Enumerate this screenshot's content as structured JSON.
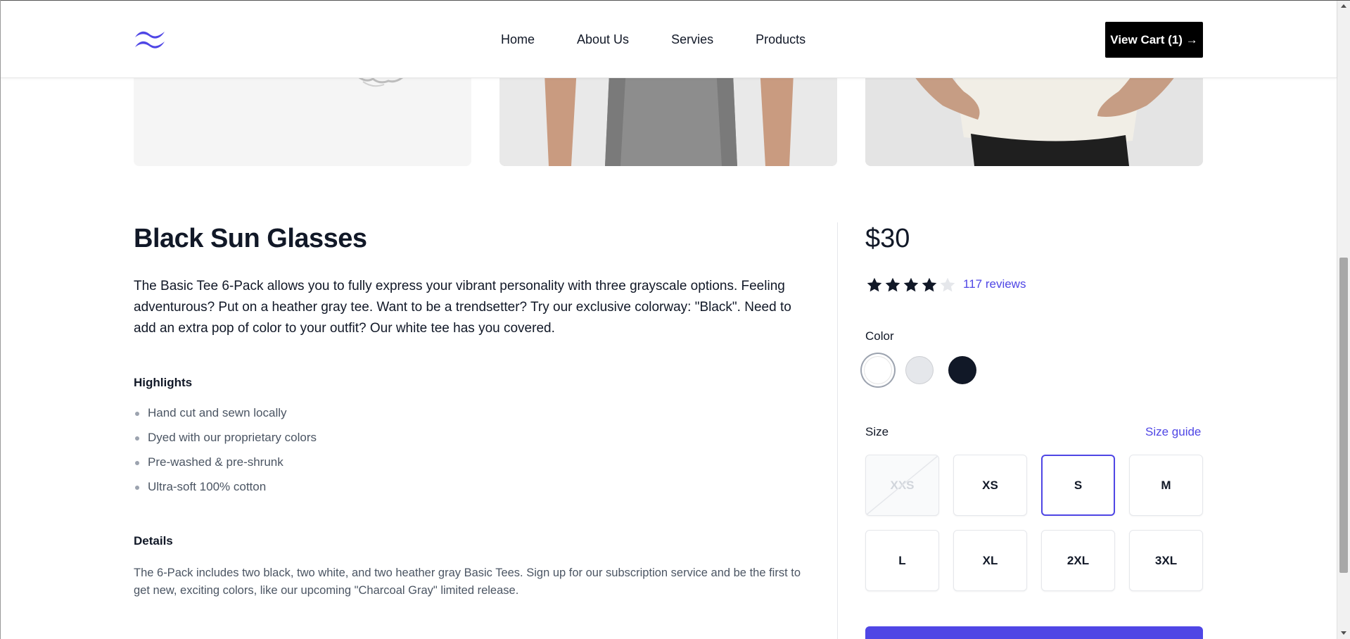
{
  "nav": {
    "links": [
      "Home",
      "About Us",
      "Servies",
      "Products"
    ],
    "cart_label": "View Cart (1) →"
  },
  "colors": {
    "accent": "#4f46e5",
    "text": "#111827",
    "muted": "#4b5563"
  },
  "product": {
    "title": "Black Sun Glasses",
    "description": "The Basic Tee 6-Pack allows you to fully express your vibrant personality with three grayscale options. Feeling adventurous? Put on a heather gray tee. Want to be a trendsetter? Try our exclusive colorway: \"Black\". Need to add an extra pop of color to your outfit? Our white tee has you covered.",
    "highlights_heading": "Highlights",
    "highlights": [
      "Hand cut and sewn locally",
      "Dyed with our proprietary colors",
      "Pre-washed & pre-shrunk",
      "Ultra-soft 100% cotton"
    ],
    "details_heading": "Details",
    "details": "The 6-Pack includes two black, two white, and two heather gray Basic Tees. Sign up for our subscription service and be the first to get new, exciting colors, like our upcoming \"Charcoal Gray\" limited release.",
    "price": "$30",
    "rating": 4,
    "rating_max": 5,
    "reviews_label": "117 reviews",
    "color_label": "Color",
    "colors": [
      {
        "name": "White",
        "hex": "#ffffff",
        "selected": true
      },
      {
        "name": "Gray",
        "hex": "#e5e7eb",
        "selected": false
      },
      {
        "name": "Black",
        "hex": "#111827",
        "selected": false
      }
    ],
    "size_label": "Size",
    "size_guide_label": "Size guide",
    "sizes": [
      {
        "label": "XXS",
        "available": false,
        "selected": false
      },
      {
        "label": "XS",
        "available": true,
        "selected": false
      },
      {
        "label": "S",
        "available": true,
        "selected": true
      },
      {
        "label": "M",
        "available": true,
        "selected": false
      },
      {
        "label": "L",
        "available": true,
        "selected": false
      },
      {
        "label": "XL",
        "available": true,
        "selected": false
      },
      {
        "label": "2XL",
        "available": true,
        "selected": false
      },
      {
        "label": "3XL",
        "available": true,
        "selected": false
      }
    ]
  }
}
